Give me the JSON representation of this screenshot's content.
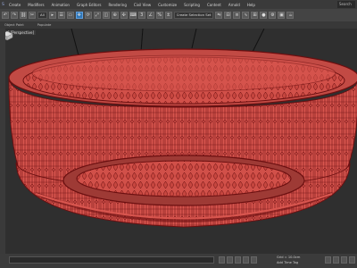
{
  "menu": {
    "app_label": "S",
    "items": [
      "Create",
      "Modifiers",
      "Animation",
      "Graph Editors",
      "Rendering",
      "Civil View",
      "Customize",
      "Scripting",
      "Content",
      "Arnold",
      "Help"
    ],
    "search_label": "Search"
  },
  "toolbar": {
    "selection_filter": "All",
    "named_selection_placeholder": "Create Selection Set"
  },
  "ribbon": {
    "tabs": [
      "Object Paint",
      "Populate"
    ]
  },
  "viewport": {
    "label": "[+] [Perspective]",
    "model_color": "#d9564f",
    "wire_color": "#6b0f10"
  },
  "status": {
    "grid_readout": "Grid = 10.0cm",
    "add_time_tag": "Add Time Tag"
  }
}
